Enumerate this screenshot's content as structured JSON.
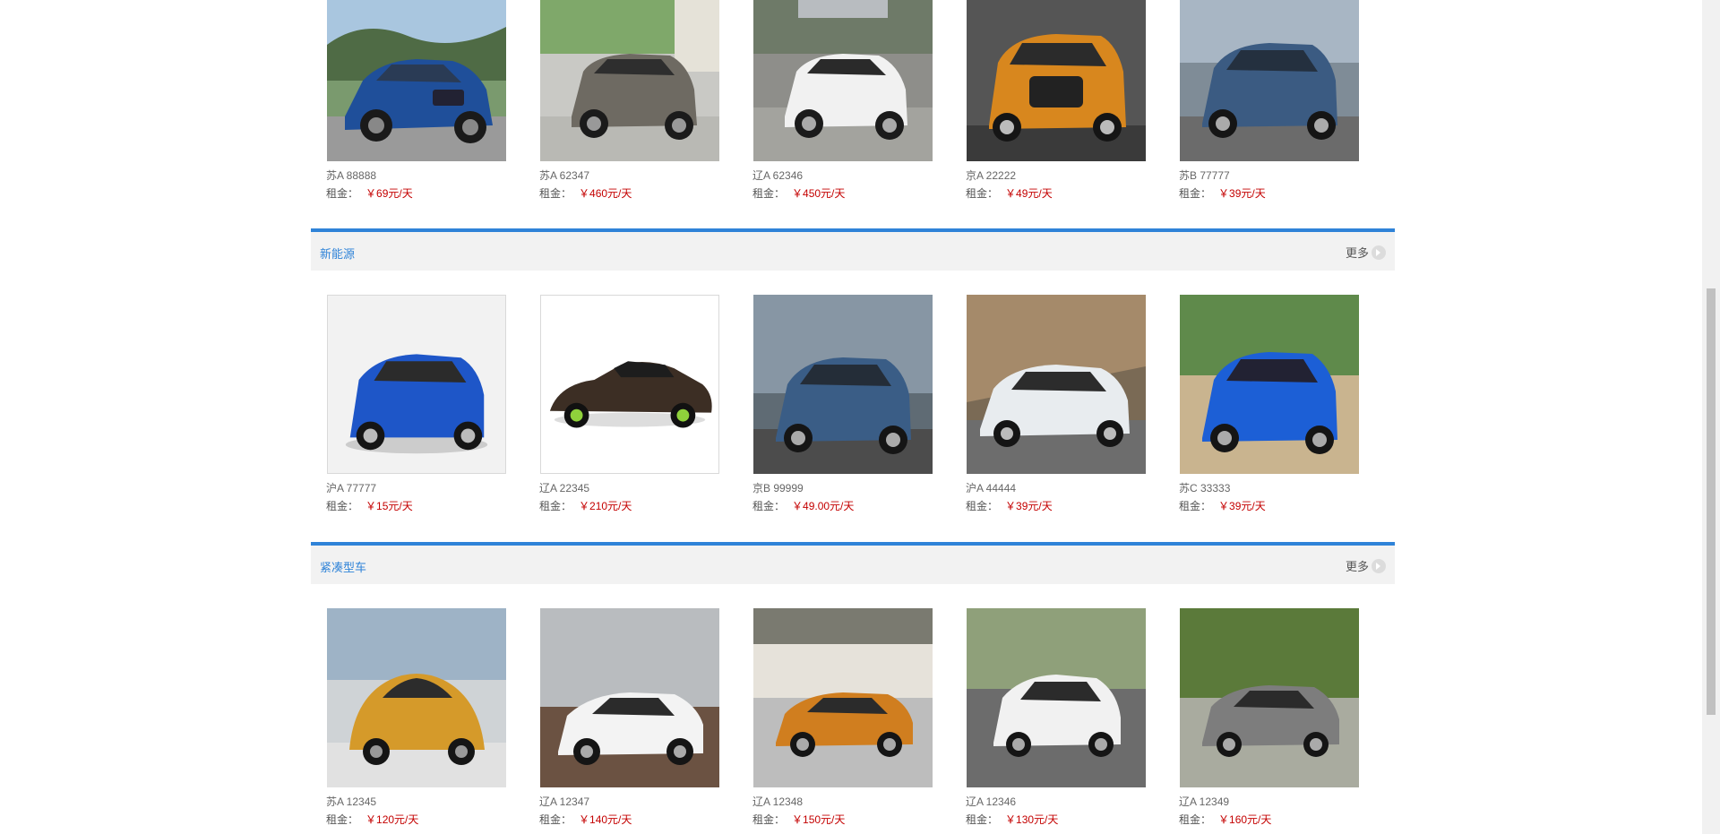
{
  "sections": [
    {
      "title": "",
      "more_label": "",
      "cars": [
        {
          "plate": "苏A 88888",
          "price_label": "租金：",
          "price": "￥69元/天",
          "image": "suv-blue-bmw"
        },
        {
          "plate": "苏A 62347",
          "price_label": "租金：",
          "price": "￥460元/天",
          "image": "suv-silver-mercedes"
        },
        {
          "plate": "辽A 62346",
          "price_label": "租金：",
          "price": "￥450元/天",
          "image": "suv-white-mercedes"
        },
        {
          "plate": "京A 22222",
          "price_label": "租金：",
          "price": "￥49元/天",
          "image": "suv-orange-audi"
        },
        {
          "plate": "苏B 77777",
          "price_label": "租金：",
          "price": "￥39元/天",
          "image": "suv-blue-peugeot"
        }
      ]
    },
    {
      "title": "新能源",
      "more_label": "更多",
      "cars": [
        {
          "plate": "沪A 77777",
          "price_label": "租金：",
          "price": "￥15元/天",
          "image": "compact-suv-blue"
        },
        {
          "plate": "辽A 22345",
          "price_label": "租金：",
          "price": "￥210元/天",
          "image": "sedan-brown-porsche"
        },
        {
          "plate": "京B 99999",
          "price_label": "租金：",
          "price": "￥49.00元/天",
          "image": "suv-blue-peugeot"
        },
        {
          "plate": "沪A 44444",
          "price_label": "租金：",
          "price": "￥39元/天",
          "image": "wagon-white-mercedes"
        },
        {
          "plate": "苏C 33333",
          "price_label": "租金：",
          "price": "￥39元/天",
          "image": "suv-blue-besturn"
        }
      ]
    },
    {
      "title": "紧凑型车",
      "more_label": "更多",
      "cars": [
        {
          "plate": "苏A 12345",
          "price_label": "租金：",
          "price": "￥120元/天",
          "image": "beetle-orange"
        },
        {
          "plate": "辽A 12347",
          "price_label": "租金：",
          "price": "￥140元/天",
          "image": "sedan-white-honda"
        },
        {
          "plate": "辽A 12348",
          "price_label": "租金：",
          "price": "￥150元/天",
          "image": "sedan-orange-honda"
        },
        {
          "plate": "辽A 12346",
          "price_label": "租金：",
          "price": "￥130元/天",
          "image": "hatchback-white-honda"
        },
        {
          "plate": "辽A 12349",
          "price_label": "租金：",
          "price": "￥160元/天",
          "image": "sedan-gray-baojun"
        }
      ]
    }
  ],
  "colors": {
    "accent": "#2f83d8",
    "price": "#c40000",
    "section_bg": "#f2f2f2"
  }
}
